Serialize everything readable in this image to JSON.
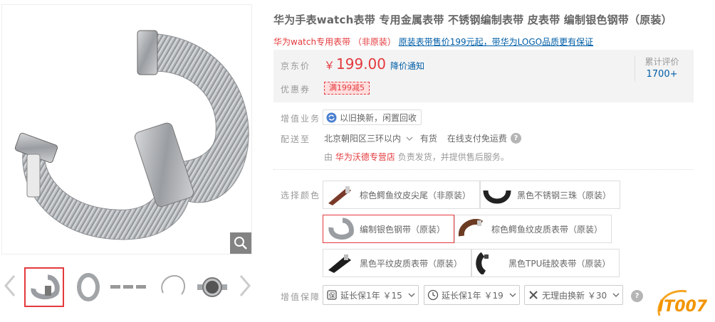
{
  "product": {
    "title": "华为手表watch表带 专用金属表带 不锈钢编制表带 皮表带 编制银色钢带（原装）",
    "promo_red": "华为watch专用表带 （非原装）",
    "promo_link": "原装表带售价199元起，带华为LOGO品质更有保证"
  },
  "price": {
    "label": "京东价",
    "currency": "￥",
    "value": "199.00",
    "notify": "降价通知",
    "coupon_label": "优惠券",
    "coupon": "满199减5",
    "review_label": "累计评价",
    "review_count": "1700+"
  },
  "service": {
    "label": "增值业务",
    "trade_in": "以旧换新，闲置回收"
  },
  "delivery": {
    "label": "配送至",
    "location": "北京朝阳区三环以内",
    "stock": "有货",
    "payment": "在线支付免运费",
    "seller_prefix": "由",
    "seller": "华为沃德专营店",
    "seller_suffix": "负责发货，并提供售后服务。"
  },
  "colors": {
    "label": "选择颜色",
    "options": [
      {
        "label": "棕色鳄鱼纹皮尖尾（非原装）",
        "selected": false
      },
      {
        "label": "黑色不锈钢三珠（原装）",
        "selected": false
      },
      {
        "label": "编制银色钢带（原装）",
        "selected": true
      },
      {
        "label": "棕色鳄鱼纹皮质表带（原装）",
        "selected": false
      },
      {
        "label": "黑色平纹皮质表带（原装）",
        "selected": false
      },
      {
        "label": "黑色TPU硅胶表带（原装）",
        "selected": false
      }
    ]
  },
  "guarantee": {
    "label": "增值保障",
    "options": [
      {
        "label": "延长保1年 ￥15",
        "icon": "warranty-icon"
      },
      {
        "label": "延长保1年 ￥19",
        "icon": "clock-icon"
      },
      {
        "label": "无理由换新 ￥30",
        "icon": "tools-icon"
      }
    ]
  },
  "watermark": "IT007",
  "colors_theme": {
    "accent": "#e4393c",
    "link": "#005ea7",
    "price_bg": "#f3f3f3"
  }
}
